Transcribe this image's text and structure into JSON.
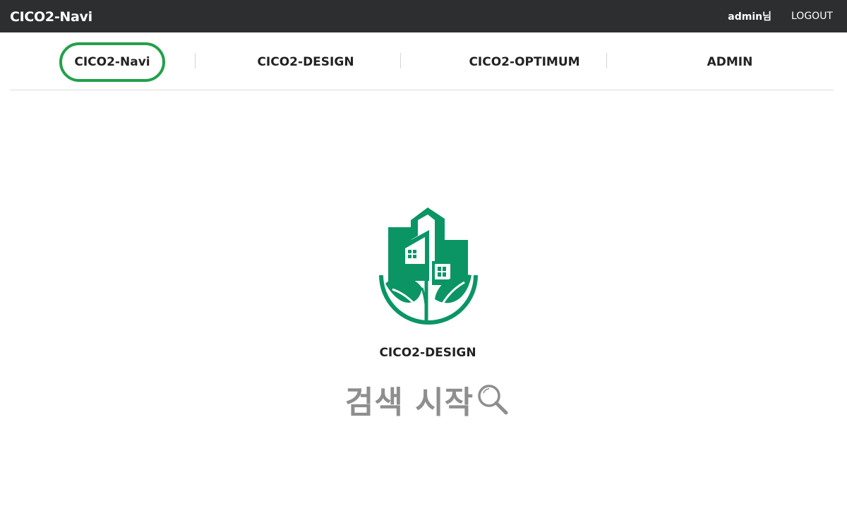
{
  "header": {
    "brand": "CICO2-Navi",
    "user": "admin님",
    "logout_label": "LOGOUT"
  },
  "nav": {
    "items": [
      {
        "label": "CICO2-Navi",
        "active": true
      },
      {
        "label": "CICO2-DESIGN",
        "active": false
      },
      {
        "label": "CICO2-OPTIMUM",
        "active": false
      },
      {
        "label": "ADMIN",
        "active": false
      }
    ]
  },
  "main": {
    "logo_icon": "green-buildings-leaf-logo",
    "logo_caption": "CICO2-DESIGN",
    "search_label": "검색 시작",
    "search_icon": "magnifier-icon"
  },
  "colors": {
    "topbar": "#2d2e30",
    "accent": "#22a04a",
    "logo_green": "#0b9565",
    "search_text": "#8e8e8e"
  }
}
